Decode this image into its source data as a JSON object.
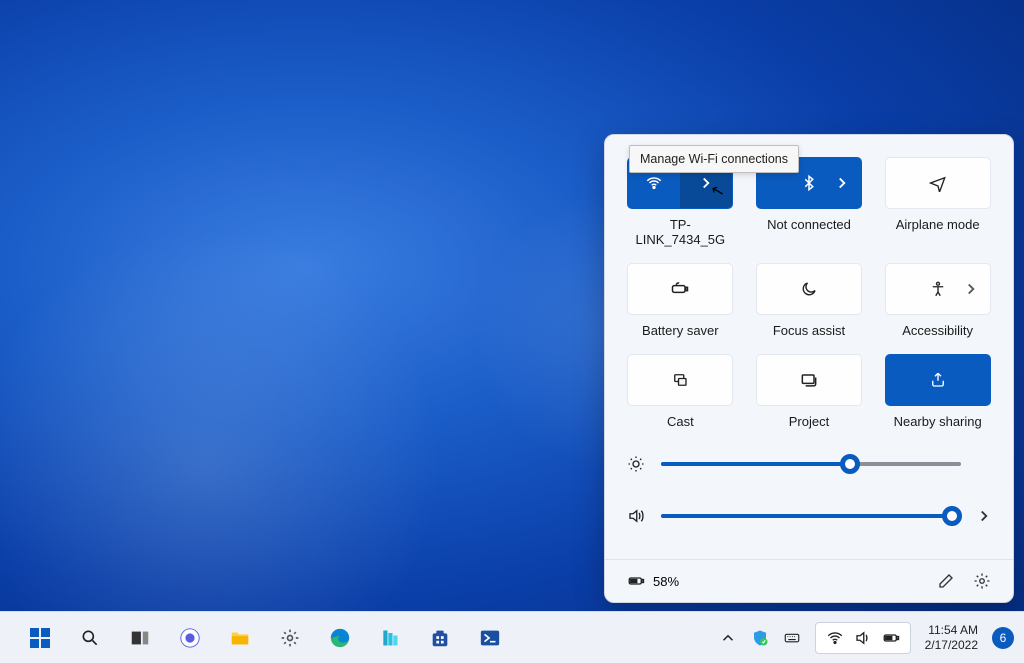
{
  "tooltip": "Manage Wi-Fi connections",
  "tiles": {
    "wifi": {
      "label": "TP-LINK_7434_5G"
    },
    "bluetooth": {
      "label": "Not connected"
    },
    "airplane": {
      "label": "Airplane mode"
    },
    "battery": {
      "label": "Battery saver"
    },
    "focus": {
      "label": "Focus assist"
    },
    "access": {
      "label": "Accessibility"
    },
    "cast": {
      "label": "Cast"
    },
    "project": {
      "label": "Project"
    },
    "nearby": {
      "label": "Nearby sharing"
    }
  },
  "sliders": {
    "brightness": {
      "percent": 63
    },
    "volume": {
      "percent": 97
    }
  },
  "footer": {
    "battery_text": "58%"
  },
  "taskbar": {
    "time": "11:54 AM",
    "date": "2/17/2022",
    "notif_count": "6"
  }
}
